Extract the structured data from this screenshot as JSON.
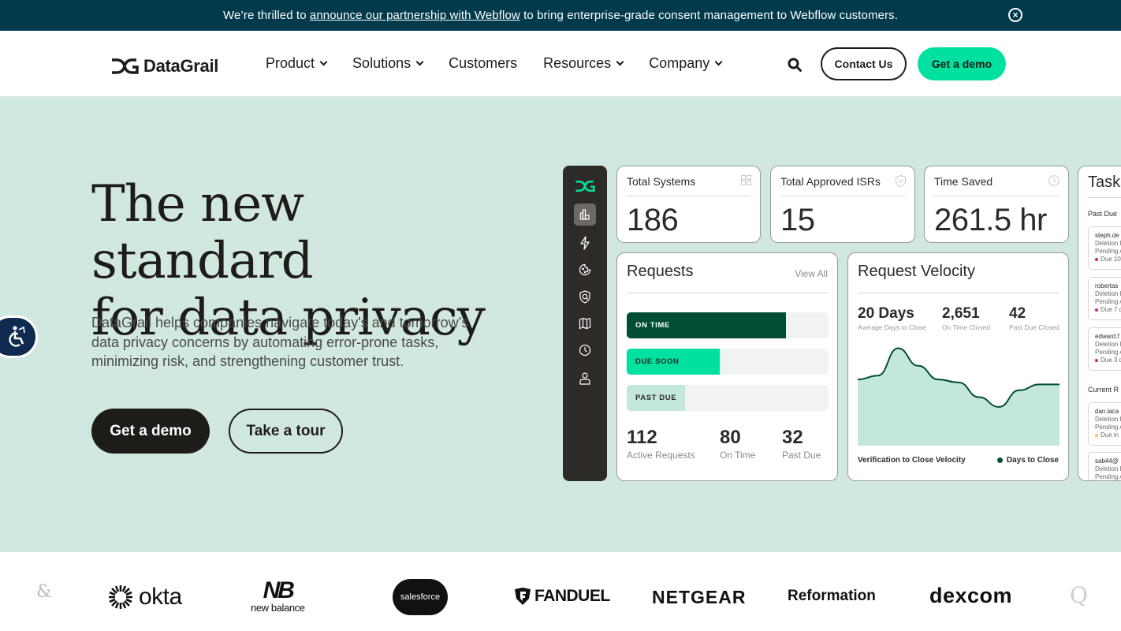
{
  "banner": {
    "prefix": "We’re thrilled to ",
    "link": "announce our partnership with Webflow",
    "suffix": " to bring enterprise-grade consent management to Webflow customers.",
    "close_icon": "close-circle-icon"
  },
  "nav": {
    "brand": "DataGrail",
    "items": [
      {
        "label": "Product",
        "has_dropdown": true
      },
      {
        "label": "Solutions",
        "has_dropdown": true
      },
      {
        "label": "Customers",
        "has_dropdown": false
      },
      {
        "label": "Resources",
        "has_dropdown": true
      },
      {
        "label": "Company",
        "has_dropdown": true
      }
    ],
    "search_icon": "search-icon",
    "contact_label": "Contact Us",
    "demo_label": "Get a demo"
  },
  "hero": {
    "headline_line1": "The new standard",
    "headline_line2": "for data privacy",
    "description": "DataGrail helps companies navigate today's and tomorrow’s data privacy concerns by automating error-prone tasks, minimizing risk, and strengthening customer trust.",
    "primary_cta": "Get a demo",
    "secondary_cta": "Take a tour"
  },
  "dashboard": {
    "sidebar_icons": [
      "logo-icon",
      "bar-chart-icon",
      "lightning-icon",
      "cookie-icon",
      "shield-search-icon",
      "map-icon",
      "clock-icon",
      "user-icon"
    ],
    "stats": [
      {
        "label": "Total Systems",
        "value": "186",
        "icon": "grid-icon"
      },
      {
        "label": "Total Approved ISRs",
        "value": "15",
        "icon": "shield-check-icon"
      },
      {
        "label": "Time Saved",
        "value": "261.5 hr",
        "icon": "clock-icon"
      }
    ],
    "requests": {
      "title": "Requests",
      "view_all": "View All",
      "bars": [
        {
          "label": "ON TIME",
          "fraction": 0.79,
          "color": "#004d33",
          "text_color": "#ffffff"
        },
        {
          "label": "DUE SOON",
          "fraction": 0.46,
          "color": "#00e09e",
          "text_color": "#2d2b27"
        },
        {
          "label": "PAST DUE",
          "fraction": 0.29,
          "color": "#c4e7dc",
          "text_color": "#2d2b27"
        }
      ],
      "totals": [
        {
          "value": "112",
          "label": "Active Requests"
        },
        {
          "value": "80",
          "label": "On Time"
        },
        {
          "value": "32",
          "label": "Past Due"
        }
      ]
    },
    "velocity": {
      "title": "Request Velocity",
      "metrics": [
        {
          "value": "20 Days",
          "label": "Average Days to Close"
        },
        {
          "value": "2,651",
          "label": "On Time Closed"
        },
        {
          "value": "42",
          "label": "Past Due Closed"
        }
      ],
      "footer_label": "Verification to Close Velocity",
      "legend_label": "Days to Close",
      "series": [
        0.66,
        0.7,
        0.98,
        0.8,
        0.66,
        0.63,
        0.48,
        0.38,
        0.55,
        0.61,
        0.61
      ]
    },
    "tasks": {
      "title": "Tasks",
      "sections": [
        {
          "label": "Past Due",
          "items": [
            {
              "user": "steph.de",
              "type": "Deletion R",
              "status": "Pending A",
              "due": "Due 10",
              "dot": "#d6246e"
            },
            {
              "user": "robertas",
              "type": "Deletion R",
              "status": "Pending A",
              "due": "Due 7 d",
              "dot": "#d6246e"
            },
            {
              "user": "edward.f",
              "type": "Deletion R",
              "status": "Pending A",
              "due": "Due 3 d",
              "dot": "#d6246e"
            }
          ]
        },
        {
          "label": "Current R",
          "items": [
            {
              "user": "dan.laca",
              "type": "Deletion R",
              "status": "Pending A",
              "due": "Due in",
              "dot": "#f2c14e"
            },
            {
              "user": "sab44@",
              "type": "Deletion R",
              "status": "Pending A",
              "due": "",
              "dot": ""
            }
          ]
        }
      ]
    }
  },
  "customer_logos": [
    "&",
    "okta",
    "new balance",
    "salesforce",
    "FANDUEL",
    "NETGEAR",
    "Reformation",
    "dexcom",
    "Q"
  ],
  "accessibility_icon": "accessibility-icon",
  "colors": {
    "brand_green": "#00e09e",
    "banner_bg": "#003a4c",
    "hero_bg": "#d1e8e0",
    "dark": "#1e1c18",
    "chart_line": "#004d33",
    "chart_fill": "#c4e7dc"
  }
}
